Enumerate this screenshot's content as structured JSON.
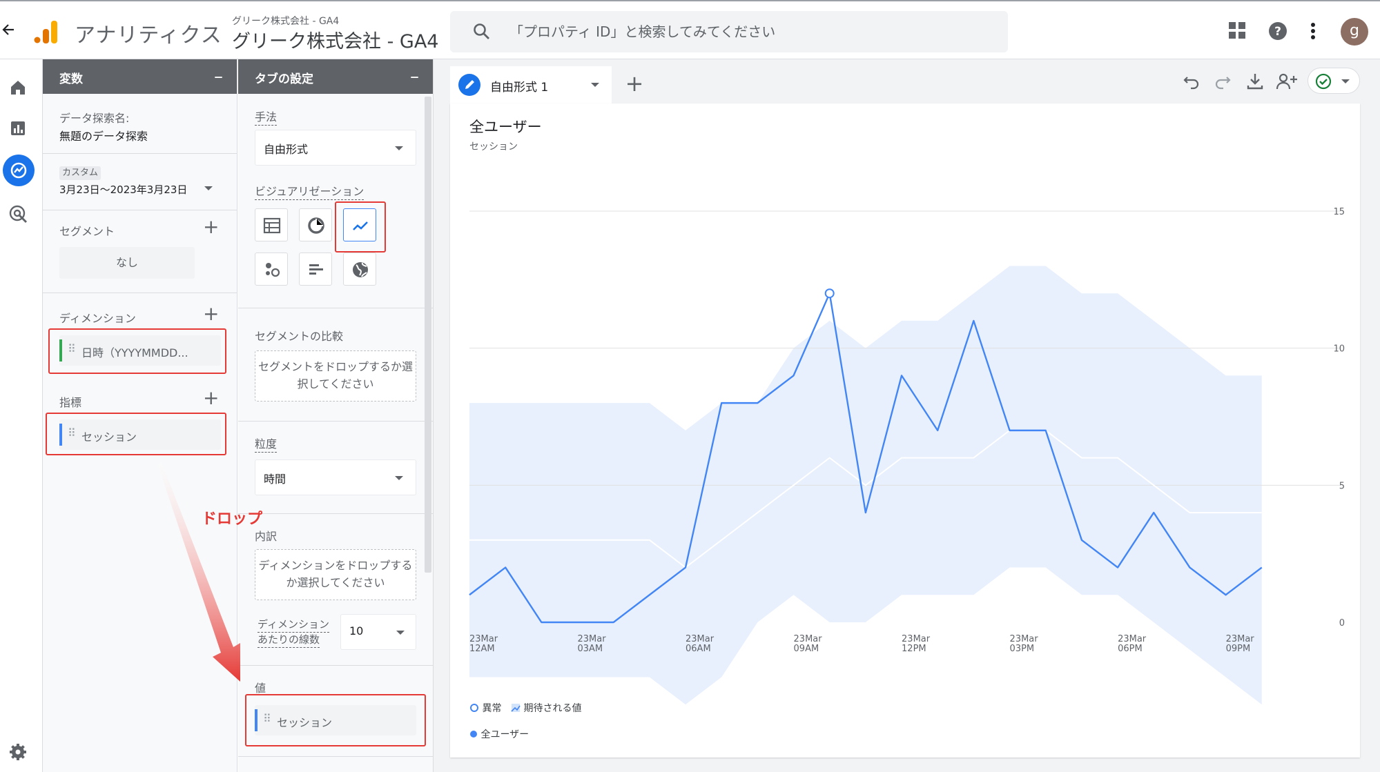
{
  "header": {
    "app_name": "アナリティクス",
    "account_sub": "グリーク株式会社 - GA4",
    "account_main": "グリーク株式会社 - GA4",
    "search_placeholder": "「プロパティ ID」と検索してみてください",
    "avatar_letter": "g"
  },
  "variables_panel": {
    "title": "変数",
    "exploration_name_label": "データ探索名:",
    "exploration_name": "無題のデータ探索",
    "date_badge": "カスタム",
    "date_range": "3月23日～2023年3月23日",
    "segments_label": "セグメント",
    "segment_none": "なし",
    "dimensions_label": "ディメンション",
    "dimension_item": "日時（YYYYMMDD...",
    "metrics_label": "指標",
    "metric_item": "セッション"
  },
  "tab_settings": {
    "title": "タブの設定",
    "technique_label": "手法",
    "technique_value": "自由形式",
    "visualization_label": "ビジュアリゼーション",
    "segment_compare_label": "セグメントの比較",
    "segment_drop_text": "セグメントをドロップするか選択してください",
    "granularity_label": "粒度",
    "granularity_value": "時間",
    "breakdown_label": "内訳",
    "breakdown_drop_text": "ディメンションをドロップするか選択してください",
    "rows_per_dim_label_1": "ディメンション",
    "rows_per_dim_label_2": "あたりの線数",
    "rows_per_dim_value": "10",
    "values_label": "値",
    "values_item": "セッション"
  },
  "annotation": {
    "drop_label": "ドロップ"
  },
  "canvas": {
    "tab_label": "自由形式 1",
    "chart_title": "全ユーザー",
    "chart_subtitle": "セッション",
    "legend_anomaly": "異常",
    "legend_expected": "期待される値",
    "legend_series": "全ユーザー"
  },
  "colors": {
    "accent": "#1a73e8",
    "line": "#4285f4",
    "band": "#e8f0fe",
    "annotation": "#e53935"
  },
  "chart_data": {
    "type": "line",
    "title": "全ユーザー",
    "ylabel": "セッション",
    "ylim": [
      0,
      15
    ],
    "y_ticks": [
      0,
      5,
      10,
      15
    ],
    "x_tick_labels": [
      [
        "23Mar",
        "12AM"
      ],
      [
        "23Mar",
        "03AM"
      ],
      [
        "23Mar",
        "06AM"
      ],
      [
        "23Mar",
        "09AM"
      ],
      [
        "23Mar",
        "12PM"
      ],
      [
        "23Mar",
        "03PM"
      ],
      [
        "23Mar",
        "06PM"
      ],
      [
        "23Mar",
        "09PM"
      ]
    ],
    "x": [
      0,
      1,
      2,
      3,
      4,
      5,
      6,
      7,
      8,
      9,
      10,
      11,
      12,
      13,
      14,
      15,
      16,
      17,
      18,
      19,
      20,
      21,
      22,
      23
    ],
    "series": [
      {
        "name": "全ユーザー",
        "values": [
          1,
          2,
          0,
          0,
          0,
          1,
          2,
          8,
          8,
          9,
          12,
          4,
          9,
          7,
          11,
          7,
          7,
          3,
          2,
          4,
          2,
          1,
          2,
          null
        ]
      }
    ],
    "expected_upper": [
      8,
      8,
      8,
      8,
      8,
      8,
      7,
      8,
      8,
      10,
      11,
      10,
      11,
      11,
      12,
      13,
      13,
      12,
      12,
      11,
      10,
      9,
      9,
      null
    ],
    "expected_mid": [
      3,
      3,
      3,
      3,
      3,
      3,
      2,
      3,
      4,
      5,
      6,
      5,
      6,
      6,
      6,
      7,
      7,
      6,
      6,
      5,
      4,
      4,
      4,
      null
    ],
    "expected_lower": [
      -2,
      -2,
      -2,
      -2,
      -2,
      -2,
      -3,
      -2,
      0,
      1,
      0,
      0,
      1,
      1,
      1,
      2,
      2,
      1,
      1,
      0,
      -1,
      -2,
      -3,
      null
    ],
    "anomaly_points": [
      10
    ],
    "legend_position": "bottom-left",
    "grid": true
  }
}
